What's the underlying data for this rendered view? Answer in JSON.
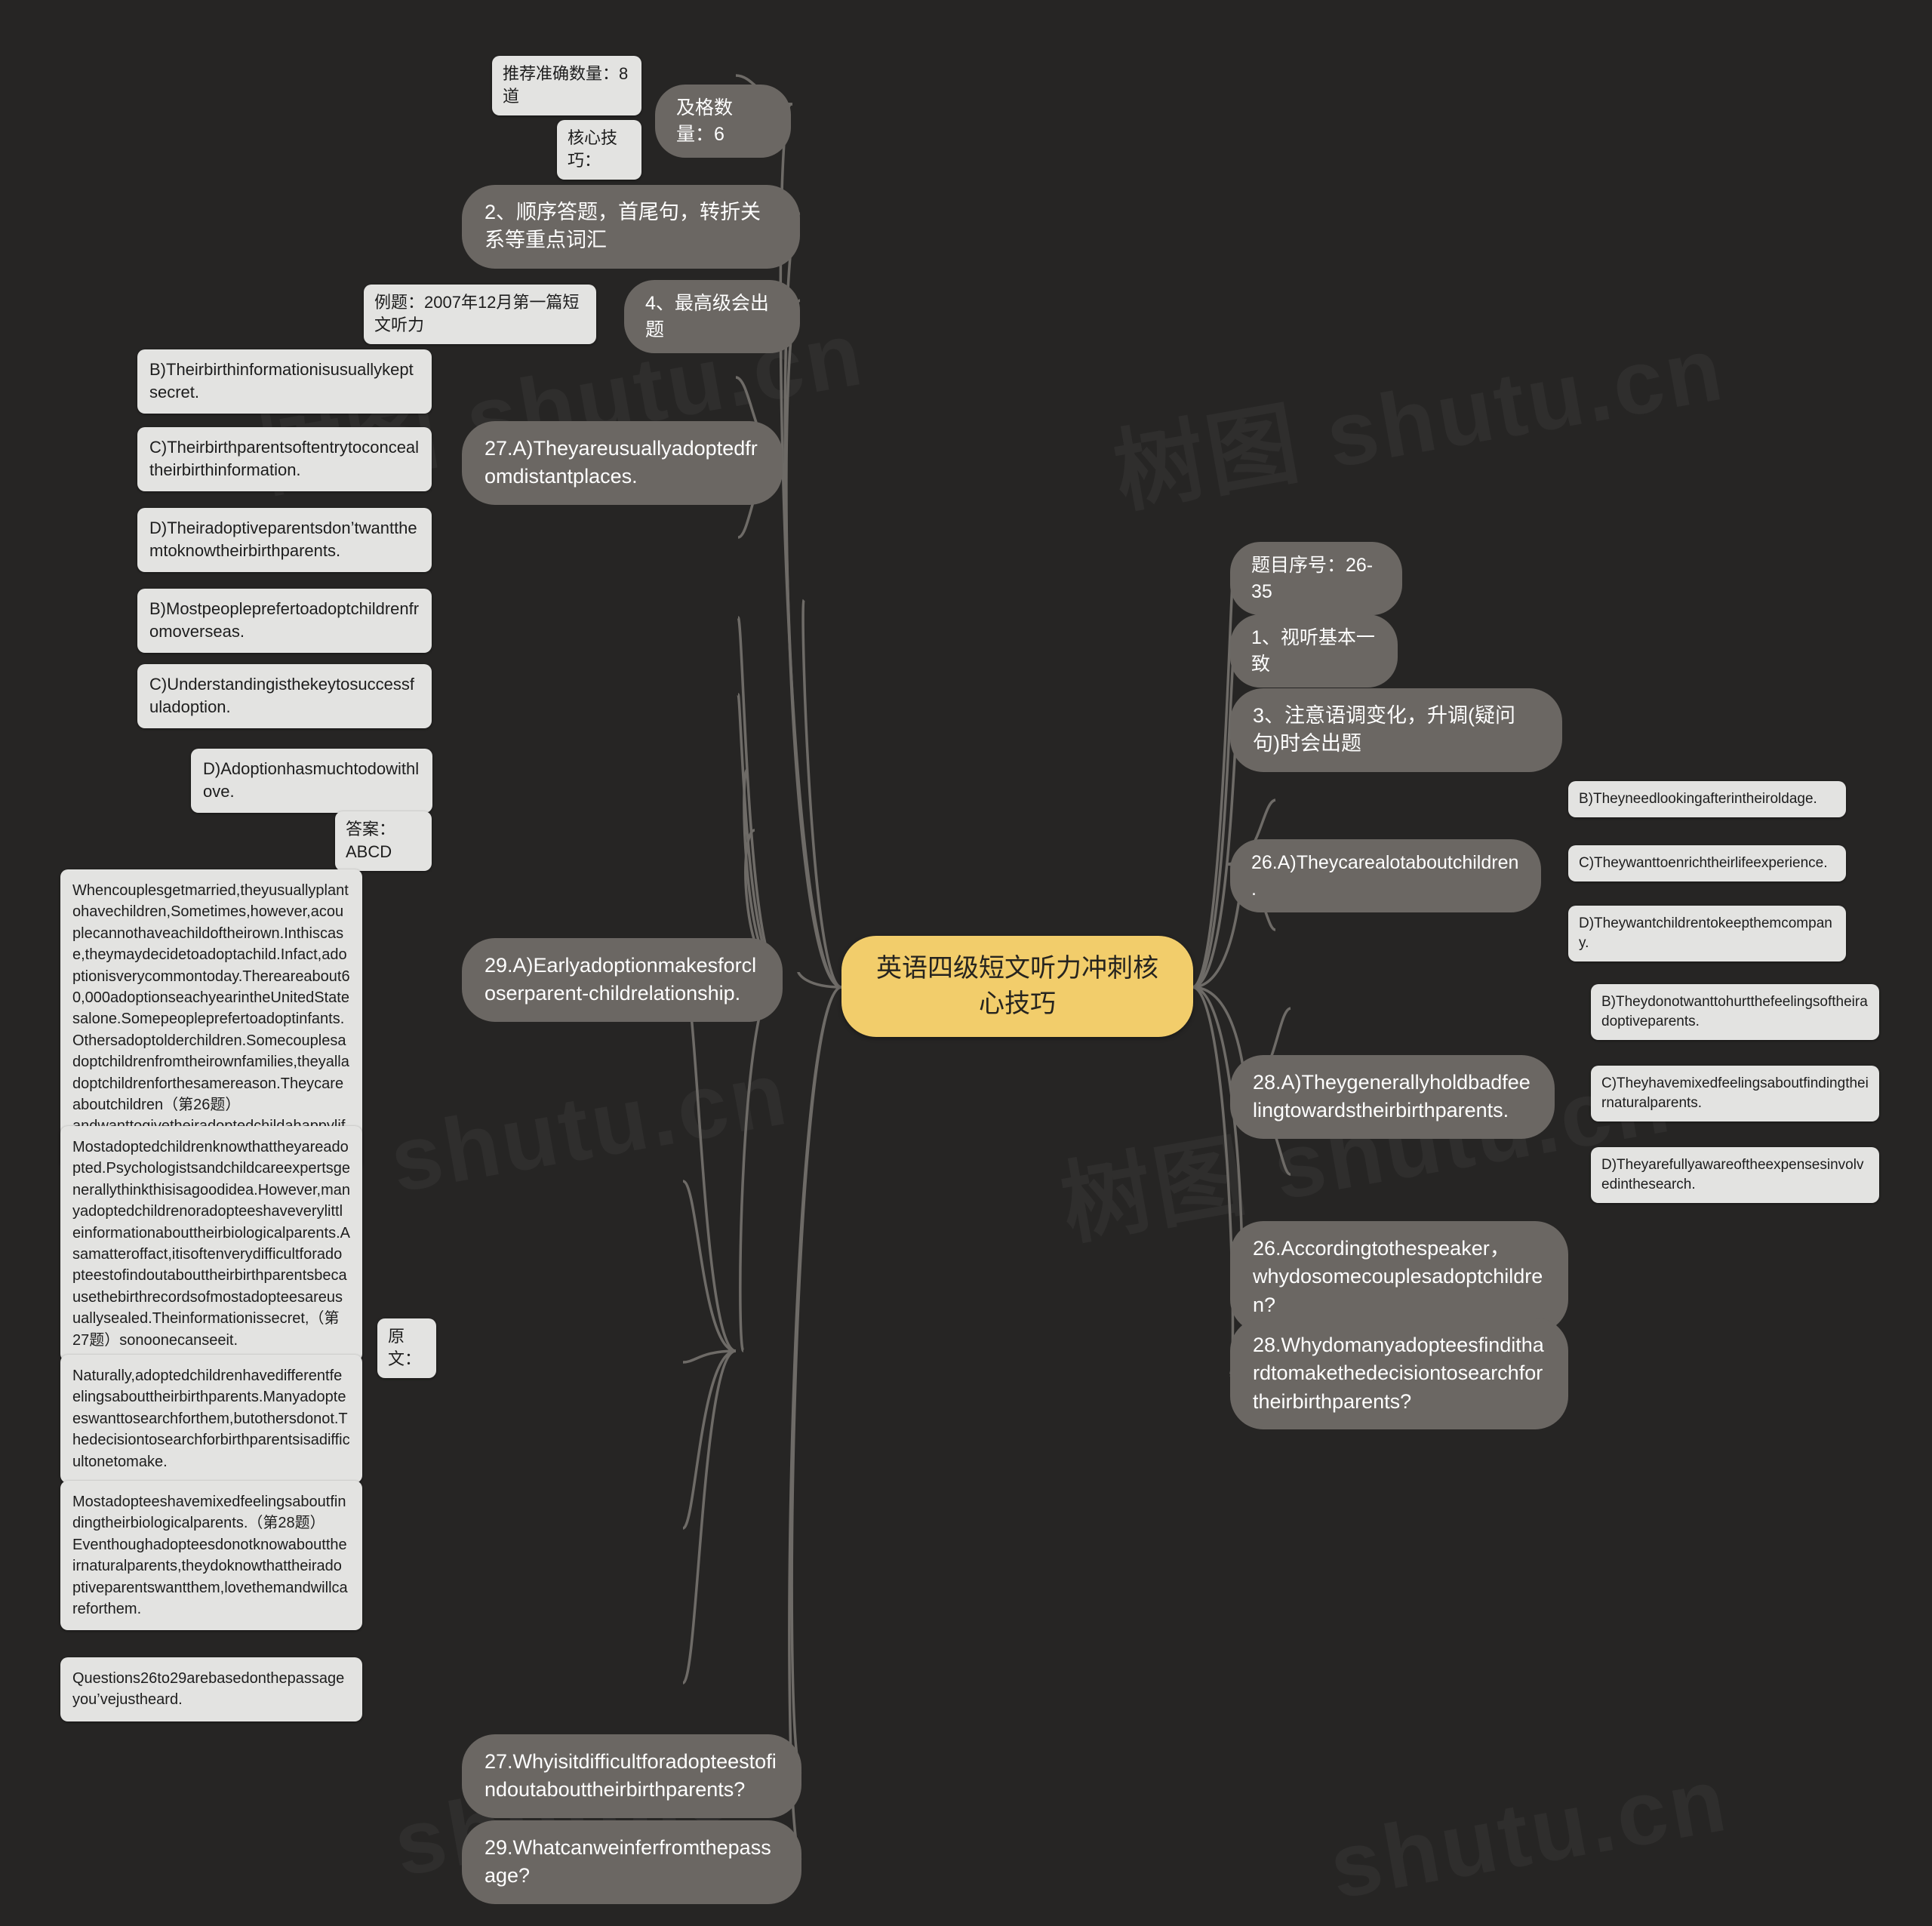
{
  "canvas": {
    "background": "#262524",
    "link_color": "#6e6b67",
    "root_color": "#f2cd6b",
    "branch_color": "#6b6763",
    "leaf_color": "#e3e3e1"
  },
  "watermark": {
    "text_a": "树图 shutu.cn",
    "text_b": "图 shutu.cn",
    "text_c": "shutu.cn"
  },
  "root": {
    "title": "英语四级短文听力冲刺核心技巧"
  },
  "left_branch": {
    "pass_count": {
      "label": "及格数量：6",
      "children": [
        "推荐准确数量：8道",
        "核心技巧："
      ]
    },
    "tip2": "2、顺序答题，首尾句，转折关系等重点词汇",
    "tip4": {
      "label": "4、最高级会出题",
      "child": "例题：2007年12月第一篇短文听力"
    },
    "answer27": {
      "label": "27.A)Theyareusuallyadoptedfromdistantplaces.",
      "options": [
        "B)Theirbirthinformationisusuallykeptsecret.",
        "C)Theirbirthparentsoftentrytoconcealtheirbirthinformation.",
        "D)Theiradoptiveparentsdon’twantthemtoknowtheirbirthparents."
      ]
    },
    "answer29": {
      "label": "29.A)Earlyadoptionmakesforcloserparent-childrelationship.",
      "options": [
        "B)Mostpeopleprefertoadoptchildrenfromoverseas.",
        "C)Understandingisthekeytosuccessfuladoption.",
        "D)Adoptionhasmuchtodowithlove."
      ],
      "answer_key": "答案：ABCD",
      "transcript_label": "原文：",
      "transcript": [
        "Whencouplesgetmarried,theyusuallyplantohavechildren,Sometimes,however,acouplecannothaveachildoftheirown.Inthiscase,theymaydecidetoadoptachild.Infact,adoptionisverycommontoday.Thereareabout60,000adoptionseachyearintheUnitedStatesalone.Somepeopleprefertoadoptinfants.Othersadoptolderchildren.Somecouplesadoptchildrenfromtheirownfamilies,theyalladoptchildrenforthesamereason.Theycareaboutchildren（第26题）andwanttogivetheiradoptedchildahappylife.",
        "Mostadoptedchildrenknowthattheyareadopted.Psychologistsandchildcareexpertsgenerallythinkthisisagoodidea.However,manyadoptedchildrenoradopteeshaveverylittleinformationabouttheirbiologicalparents.Asamatteroffact,itisoftenverydifficultforadopteestofindoutabouttheirbirthparentsbecausethebirthrecordsofmostadopteesareusuallysealed.Theinformationissecret,（第27题）sonoonecanseeit.",
        "Naturally,adoptedchildrenhavedifferentfeelingsabouttheirbirthparents.Manyadopteeswanttosearchforthem,butothersdonot.Thedecisiontosearchforbirthparentsisadifficultonetomake.",
        "Mostadopteeshavemixedfeelingsaboutfindingtheirbiologicalparents.（第28题）Eventhoughadopteesdonotknowabouttheirnaturalparents,theydoknowthattheiradoptiveparentswantthem,lovethemandwillcareforthem.",
        "Questions26to29arebasedonthepassageyou’vejustheard."
      ]
    },
    "question27": "27.Whyisitdifficultforadopteestofindoutabouttheirbirthparents?",
    "question29": "29.Whatcanweinferfromthepassage?"
  },
  "right_branch": {
    "item_number": "题目序号：26-35",
    "tip1": "1、视听基本一致",
    "tip3": "3、注意语调变化，升调(疑问句)时会出题",
    "answer26": {
      "label": "26.A)Theycarealotaboutchildren.",
      "options": [
        "B)Theyneedlookingafterintheiroldage.",
        "C)Theywanttoenrichtheirlifeexperience.",
        "D)Theywantchildrentokeepthemcompany."
      ]
    },
    "answer28": {
      "label": "28.A)Theygenerallyholdbadfeelingtowardstheirbirthparents.",
      "options": [
        "B)Theydonotwanttohurtthefeelingsoftheiradoptiveparents.",
        "C)Theyhavemixedfeelingsaboutfindingtheirnaturalparents.",
        "D)Theyarefullyawareoftheexpensesinvolvedinthesearch."
      ]
    },
    "question26": "26.Accordingtothespeaker，whydosomecouplesadoptchildren?",
    "question28": "28.Whydomanyadopteesfindithardtomakethedecisiontosearchfortheirbirthparents?"
  }
}
